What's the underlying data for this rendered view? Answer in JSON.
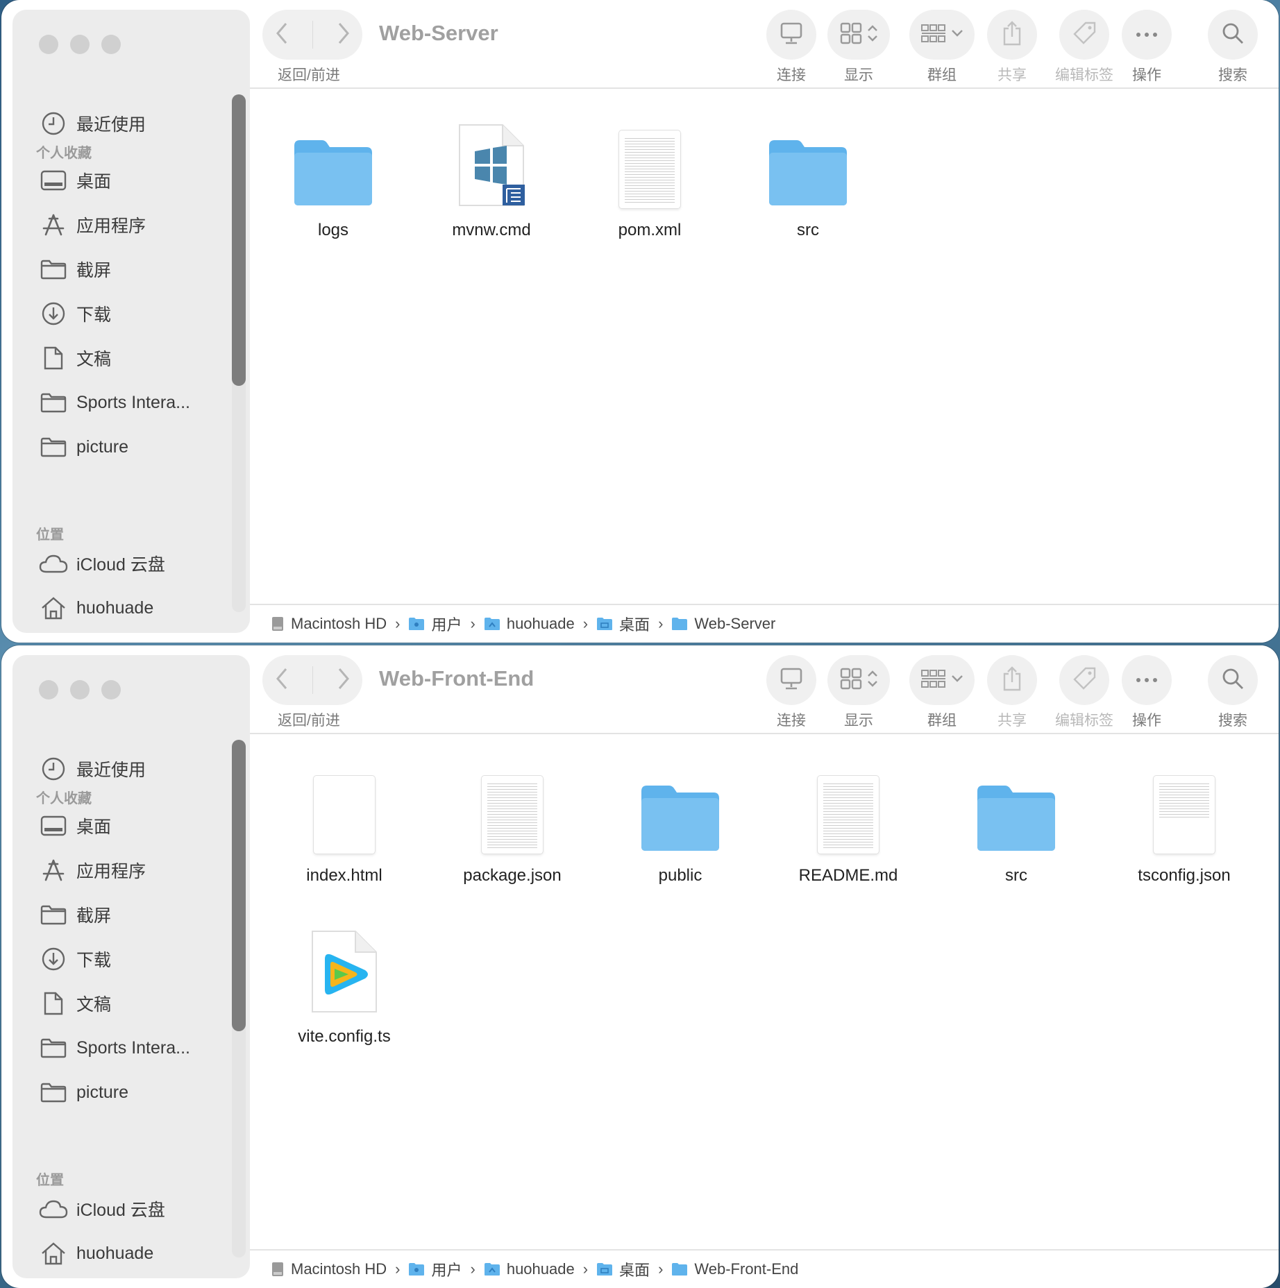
{
  "window1": {
    "title": "Web-Server",
    "nav_label": "返回/前进",
    "toolbar": {
      "connect": "连接",
      "view": "显示",
      "group": "群组",
      "share": "共享",
      "tags": "编辑标签",
      "action": "操作",
      "search": "搜索"
    },
    "sidebar": {
      "recent": "最近使用",
      "favorites_header": "个人收藏",
      "desktop": "桌面",
      "applications": "应用程序",
      "screenshots": "截屏",
      "downloads": "下载",
      "documents": "文稿",
      "sports": "Sports Intera...",
      "picture": "picture",
      "locations_header": "位置",
      "icloud": "iCloud 云盘",
      "home": "huohuade"
    },
    "files": [
      {
        "name": "logs",
        "type": "folder"
      },
      {
        "name": "mvnw.cmd",
        "type": "windows-cmd"
      },
      {
        "name": "pom.xml",
        "type": "text-doc"
      },
      {
        "name": "src",
        "type": "folder"
      }
    ],
    "path": [
      "Macintosh HD",
      "用户",
      "huohuade",
      "桌面",
      "Web-Server"
    ]
  },
  "window2": {
    "title": "Web-Front-End",
    "nav_label": "返回/前进",
    "toolbar": {
      "connect": "连接",
      "view": "显示",
      "group": "群组",
      "share": "共享",
      "tags": "编辑标签",
      "action": "操作",
      "search": "搜索"
    },
    "sidebar": {
      "recent": "最近使用",
      "favorites_header": "个人收藏",
      "desktop": "桌面",
      "applications": "应用程序",
      "screenshots": "截屏",
      "downloads": "下载",
      "documents": "文稿",
      "sports": "Sports Intera...",
      "picture": "picture",
      "locations_header": "位置",
      "icloud": "iCloud 云盘",
      "home": "huohuade"
    },
    "files": [
      {
        "name": "index.html",
        "type": "blank-doc"
      },
      {
        "name": "package.json",
        "type": "text-doc"
      },
      {
        "name": "public",
        "type": "folder"
      },
      {
        "name": "README.md",
        "type": "text-doc"
      },
      {
        "name": "src",
        "type": "folder"
      },
      {
        "name": "tsconfig.json",
        "type": "text-doc"
      },
      {
        "name": "vite.config.ts",
        "type": "video-app-doc"
      }
    ],
    "path": [
      "Macintosh HD",
      "用户",
      "huohuade",
      "桌面",
      "Web-Front-End"
    ]
  },
  "colors": {
    "folder": "#5fb3ec",
    "folder_top": "#8fd0f7",
    "accent": "#2f8fe0"
  }
}
